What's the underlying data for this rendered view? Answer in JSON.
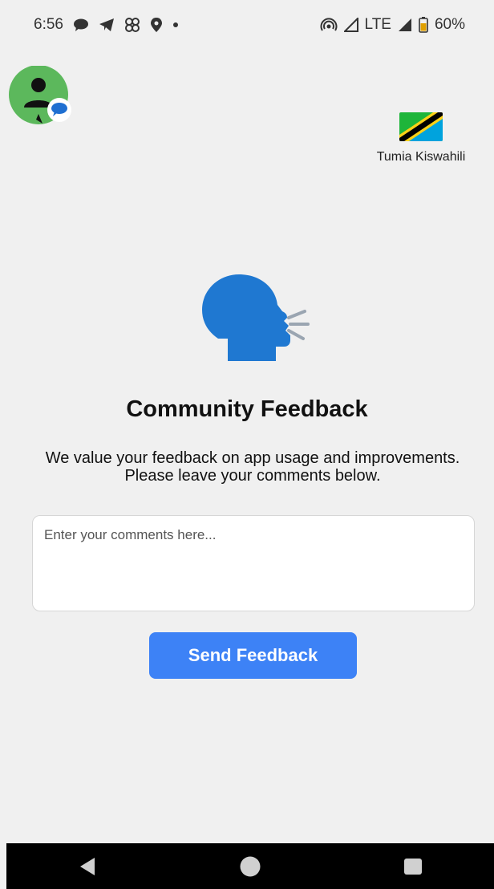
{
  "status_bar": {
    "time": "6:56",
    "network": "LTE",
    "battery": "60%",
    "left_icons": [
      "chat-bubble-icon",
      "telegram-icon",
      "pinwheel-icon",
      "location-pin-icon",
      "dot-icon"
    ],
    "right_icons": [
      "hotspot-icon",
      "signal-icon",
      "signal-icon",
      "battery-icon"
    ]
  },
  "chat_head": {
    "icon": "person-chat-icon",
    "bg_color": "#5cb85c",
    "badge_color": "#1f6fd1"
  },
  "language_toggle": {
    "flag_icon": "tanzania-flag-icon",
    "label": "Tumia Kiswahili"
  },
  "hero_icon": "speaking-head-icon",
  "feedback": {
    "title": "Community Feedback",
    "description": "We value your feedback on app usage and improvements. Please leave your comments below.",
    "comment_placeholder": "Enter your comments here...",
    "comment_value": "",
    "send_button_label": "Send Feedback"
  },
  "colors": {
    "background": "#f0f0f0",
    "accent": "#3d82f6",
    "hero_icon": "#1f78d1"
  },
  "nav_bar": {
    "buttons": [
      "back-icon",
      "home-icon",
      "recents-icon"
    ]
  }
}
